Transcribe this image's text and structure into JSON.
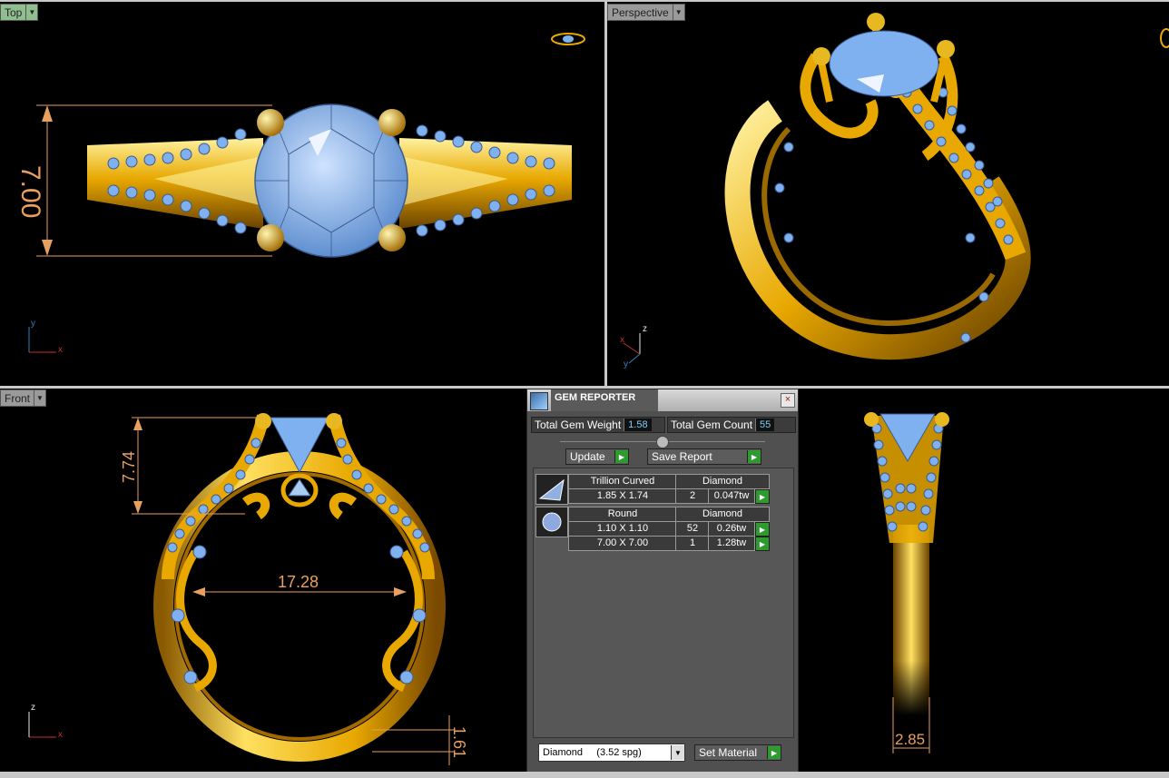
{
  "viewports": {
    "top": {
      "label": "Top",
      "dimension": "7.00",
      "axes": {
        "a": "y",
        "b": "x"
      }
    },
    "perspective": {
      "label": "Perspective",
      "axes": {
        "a": "z",
        "b": "x",
        "c": "y"
      }
    },
    "front": {
      "label": "Front",
      "dimension_height": "7.74",
      "dimension_width": "17.28",
      "dimension_base": "1.61",
      "axes": {
        "a": "z",
        "b": "x"
      }
    },
    "right": {
      "dimension_width": "2.85"
    }
  },
  "gem_reporter": {
    "title": "GEM REPORTER",
    "close": "×",
    "total_weight_label": "Total Gem Weight",
    "total_weight_value": "1.58",
    "total_count_label": "Total Gem Count",
    "total_count_value": "55",
    "update_label": "Update",
    "save_report_label": "Save Report",
    "groups": [
      {
        "shape": "Trillion Curved",
        "material": "Diamond",
        "rows": [
          {
            "size": "1.85 X 1.74",
            "count": "2",
            "weight": "0.047tw"
          }
        ]
      },
      {
        "shape": "Round",
        "material": "Diamond",
        "rows": [
          {
            "size": "1.10 X 1.10",
            "count": "52",
            "weight": "0.26tw"
          },
          {
            "size": "7.00 X 7.00",
            "count": "1",
            "weight": "1.28tw"
          }
        ]
      }
    ],
    "material_select": "Diamond     (3.52 spg)",
    "set_material_label": "Set Material"
  },
  "colors": {
    "gold": "#e8a800",
    "gem": "#7fb0f0",
    "dimension": "#e8a060"
  }
}
